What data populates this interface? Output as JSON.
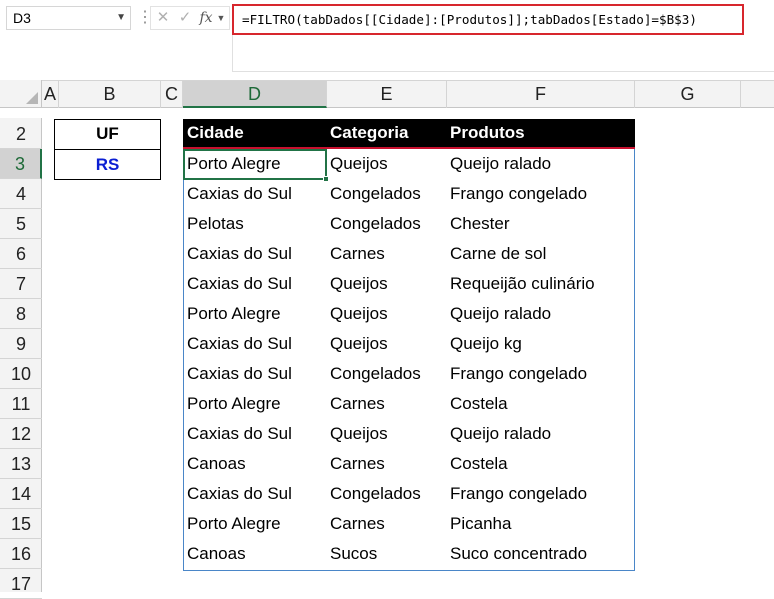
{
  "name_box": {
    "value": "D3"
  },
  "formula_bar": {
    "formula": "=FILTRO(tabDados[[Cidade]:[Produtos]];tabDados[Estado]=$B$3)",
    "cancel_glyph": "✕",
    "enter_glyph": "✓",
    "fx_label": "fx"
  },
  "columns": [
    "A",
    "B",
    "C",
    "D",
    "E",
    "F",
    "G"
  ],
  "rows": [
    "2",
    "3",
    "4",
    "5",
    "6",
    "7",
    "8",
    "9",
    "10",
    "11",
    "12",
    "13",
    "14",
    "15",
    "16",
    "17"
  ],
  "selected_column": "D",
  "selected_row": "3",
  "uf_block": {
    "label": "UF",
    "value": "RS"
  },
  "table": {
    "headers": [
      "Cidade",
      "Categoria",
      "Produtos"
    ],
    "rows": [
      [
        "Porto Alegre",
        "Queijos",
        "Queijo ralado"
      ],
      [
        "Caxias do Sul",
        "Congelados",
        "Frango congelado"
      ],
      [
        "Pelotas",
        "Congelados",
        "Chester"
      ],
      [
        "Caxias do Sul",
        "Carnes",
        "Carne de sol"
      ],
      [
        "Caxias do Sul",
        "Queijos",
        "Requeijão culinário"
      ],
      [
        "Porto Alegre",
        "Queijos",
        "Queijo ralado"
      ],
      [
        "Caxias do Sul",
        "Queijos",
        "Queijo kg"
      ],
      [
        "Caxias do Sul",
        "Congelados",
        "Frango congelado"
      ],
      [
        "Porto Alegre",
        "Carnes",
        "Costela"
      ],
      [
        "Caxias do Sul",
        "Queijos",
        "Queijo ralado"
      ],
      [
        "Canoas",
        "Carnes",
        "Costela"
      ],
      [
        "Caxias do Sul",
        "Congelados",
        "Frango congelado"
      ],
      [
        "Porto Alegre",
        "Carnes",
        "Picanha"
      ],
      [
        "Canoas",
        "Sucos",
        "Suco concentrado"
      ]
    ]
  },
  "colors": {
    "selection_green": "#217346",
    "formula_highlight_red": "#d7262d",
    "uf_value_blue": "#0b1fd3",
    "table_header_bg": "#000000",
    "table_header_accent": "#c8102e"
  }
}
